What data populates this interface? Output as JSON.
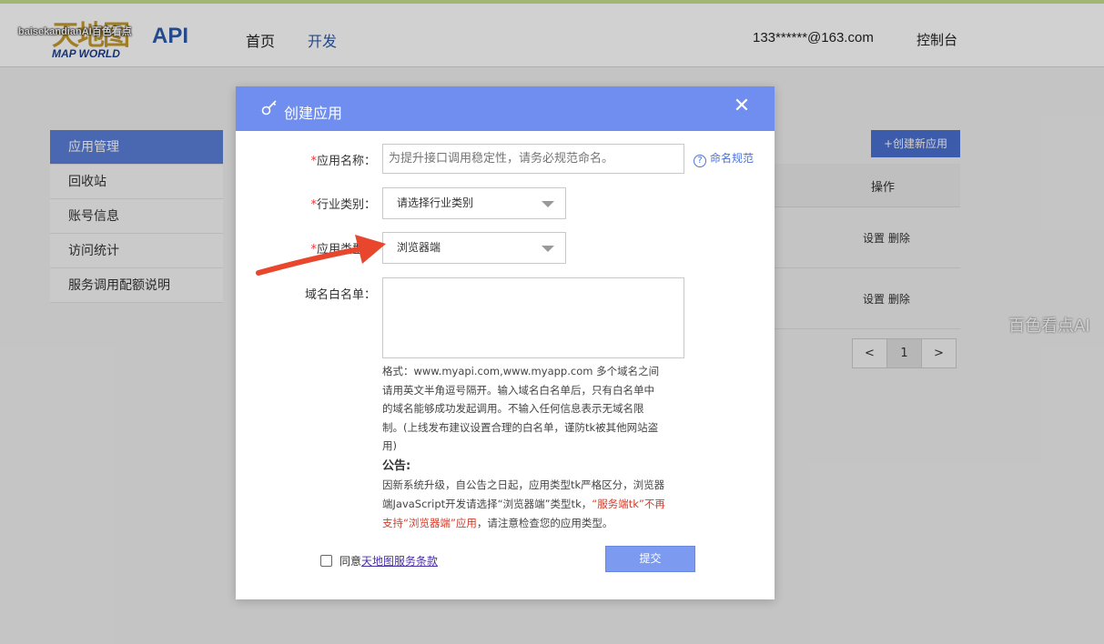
{
  "header": {
    "logo_chars": "天地图",
    "logo_api": "API",
    "logo_sub": "MAP WORLD",
    "watermark": "baisekandianAI百色看点",
    "nav": [
      "首页",
      "开发"
    ],
    "user": "133******@163.com",
    "console": "控制台"
  },
  "sidebar": {
    "items": [
      {
        "label": "应用管理",
        "active": true
      },
      {
        "label": "回收站"
      },
      {
        "label": "账号信息"
      },
      {
        "label": "访问统计"
      },
      {
        "label": "服务调用配额说明"
      }
    ]
  },
  "main": {
    "create_button": "+创建新应用",
    "table_header_ops": "操作",
    "rows": [
      {
        "ops": "设置  删除"
      },
      {
        "ops": "设置  删除"
      }
    ],
    "pager": {
      "prev": "<",
      "page": "1",
      "next": ">"
    }
  },
  "watermark_right": "百色看点AI",
  "modal": {
    "title": "创建应用",
    "close": "✕",
    "fields": {
      "name_label": "应用名称：",
      "name_placeholder": "为提升接口调用稳定性，请务必规范命名。",
      "naming_link": "命名规范",
      "industry_label": "行业类别：",
      "industry_value": "请选择行业类别",
      "type_label": "应用类型：",
      "type_value": "浏览器端",
      "whitelist_label": "域名白名单："
    },
    "hint": "格式：www.myapi.com,www.myapp.com 多个域名之间请用英文半角逗号隔开。输入域名白名单后，只有白名单中的域名能够成功发起调用。不输入任何信息表示无域名限制。(上线发布建议设置合理的白名单，谨防tk被其他网站盗用)",
    "notice_title": "公告:",
    "notice_part1": "因新系统升级，自公告之日起，应用类型tk严格区分，浏览器端JavaScript开发请选择“浏览器端”类型tk，",
    "notice_red": "“服务端tk”不再支持“浏览器端”应用",
    "notice_part2": "，请注意检查您的应用类型。",
    "agree_prefix": "同意",
    "agree_link": "天地图服务条款",
    "submit": "提交"
  },
  "colors": {
    "modal_header": "#6f8ef0",
    "sidebar_active": "#5b7fd8",
    "annotation_arrow": "#e8472e"
  }
}
